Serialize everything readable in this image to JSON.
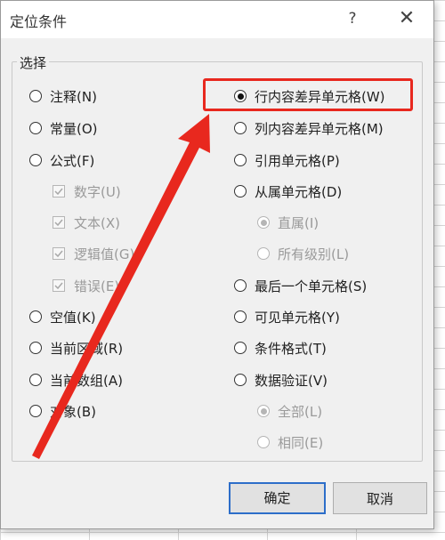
{
  "dialog": {
    "title": "定位条件",
    "help_label": "?",
    "close_label": "✕"
  },
  "group": {
    "label": "选择"
  },
  "left_options": [
    {
      "label": "注释(N)",
      "selected": false
    },
    {
      "label": "常量(O)",
      "selected": false
    },
    {
      "label": "公式(F)",
      "selected": false
    },
    {
      "label": "空值(K)",
      "selected": false
    },
    {
      "label": "当前区域(R)",
      "selected": false
    },
    {
      "label": "当前数组(A)",
      "selected": false
    },
    {
      "label": "对象(B)",
      "selected": false
    }
  ],
  "formula_suboptions": [
    {
      "label": "数字(U)",
      "checked": true
    },
    {
      "label": "文本(X)",
      "checked": true
    },
    {
      "label": "逻辑值(G)",
      "checked": true
    },
    {
      "label": "错误(E)",
      "checked": true
    }
  ],
  "right_options": [
    {
      "label": "行内容差异单元格(W)",
      "selected": true
    },
    {
      "label": "列内容差异单元格(M)",
      "selected": false
    },
    {
      "label": "引用单元格(P)",
      "selected": false
    },
    {
      "label": "从属单元格(D)",
      "selected": false
    },
    {
      "label": "最后一个单元格(S)",
      "selected": false
    },
    {
      "label": "可见单元格(Y)",
      "selected": false
    },
    {
      "label": "条件格式(T)",
      "selected": false
    },
    {
      "label": "数据验证(V)",
      "selected": false
    }
  ],
  "dependents_suboptions": [
    {
      "label": "直属(I)",
      "selected": true
    },
    {
      "label": "所有级别(L)",
      "selected": false
    }
  ],
  "validation_suboptions": [
    {
      "label": "全部(L)",
      "selected": true
    },
    {
      "label": "相同(E)",
      "selected": false
    }
  ],
  "buttons": {
    "ok": "确定",
    "cancel": "取消"
  },
  "colors": {
    "highlight": "#e8281e",
    "arrow": "#e8281e",
    "ok_border": "#2d6ec9"
  }
}
